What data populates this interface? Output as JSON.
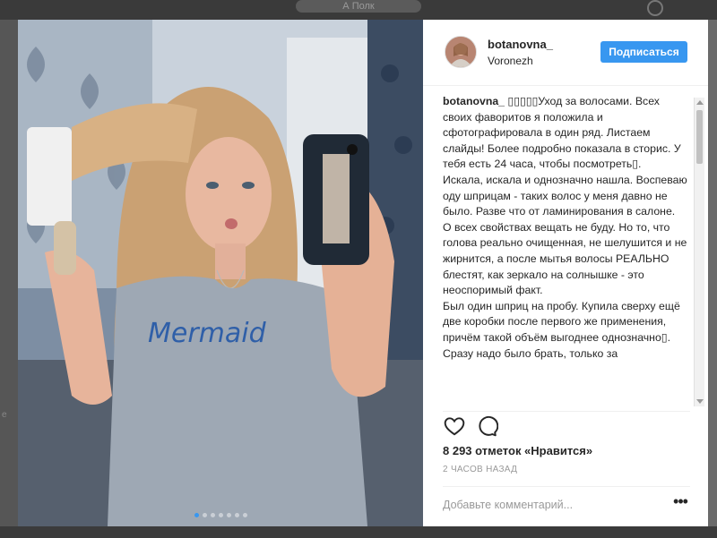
{
  "background": {
    "pill_label": "А Полк",
    "side_letter": "e"
  },
  "post": {
    "photo": {
      "icon": "selfie-photo",
      "shirt_text": "Mermaid",
      "carousel_index": 1,
      "carousel_count": 7
    },
    "author": {
      "username": "botanovna_",
      "location": "Voronezh",
      "follow_label": "Подписаться"
    },
    "caption": {
      "username": "botanovna_",
      "text": " ▯▯▯▯▯Уход за волосами. Всех своих фаворитов я положила и сфотографировала в один ряд. Листаем слайды! Более подробно показала в сторис. У тебя есть 24 часа, чтобы посмотреть▯.",
      "paragraphs": [
        "Искала, искала и однозначно нашла. Воспеваю оду шприцам - таких волос у меня давно не было. Разве что от ламинирования в салоне.",
        "О всех свойствах вещать не буду. Но то, что голова реально очищенная, не шелушится и не жирнится, а после мытья волосы РЕАЛЬНО блестят, как зеркало на солнышке - это неоспоримый факт.",
        "Был один шприц на пробу. Купила сверху ещё две коробки после первого же применения, причём такой объём выгоднее однозначно▯.",
        "Сразу надо было брать, только за"
      ]
    },
    "likes_text": "8 293 отметок «Нравится»",
    "time_text": "2 ЧАСОВ НАЗАД",
    "comment_placeholder": "Добавьте комментарий...",
    "more_label": "•••",
    "colors": {
      "accent": "#3897f0",
      "text": "#262626",
      "muted": "#999999"
    }
  }
}
